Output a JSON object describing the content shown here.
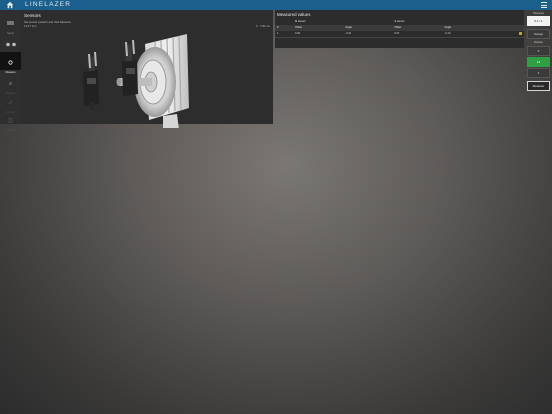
{
  "app": {
    "brand": "LINELAZER"
  },
  "sidebar": {
    "items": [
      {
        "label": "Setup",
        "state": "normal"
      },
      {
        "label": "Sensors",
        "state": "normal"
      },
      {
        "label": "Measure",
        "state": "active"
      },
      {
        "label": "Results",
        "state": "disabled"
      },
      {
        "label": "Correct",
        "state": "disabled"
      },
      {
        "label": "Report",
        "state": "disabled"
      }
    ]
  },
  "sensors": {
    "title": "Sensors",
    "subtitle": "Set sensor position and click Measure",
    "left_info": "1:15.7 mm",
    "right_info": "9 · 7.05 mm"
  },
  "measured": {
    "title": "Measured values",
    "groups": [
      "M sensor",
      "S sensor"
    ],
    "headers": [
      "#",
      "Offset",
      "Angle",
      "Offset",
      "Angle"
    ],
    "rows": [
      {
        "n": "1",
        "m_offset": "0.00",
        "m_angle": "-0.10",
        "s_offset": "0.07",
        "s_angle": "-0.10"
      }
    ]
  },
  "right": {
    "tolerance_label": "Tolerance",
    "tolerance_value": "0.1 / 1",
    "sweep_label": "Sweep",
    "position_label": "Position",
    "positions": [
      "9",
      "12",
      "3"
    ],
    "active_position": "12",
    "measure_label": "Measure"
  },
  "colors": {
    "topbar": "#1b5f8c",
    "active_green": "#2ea043"
  }
}
